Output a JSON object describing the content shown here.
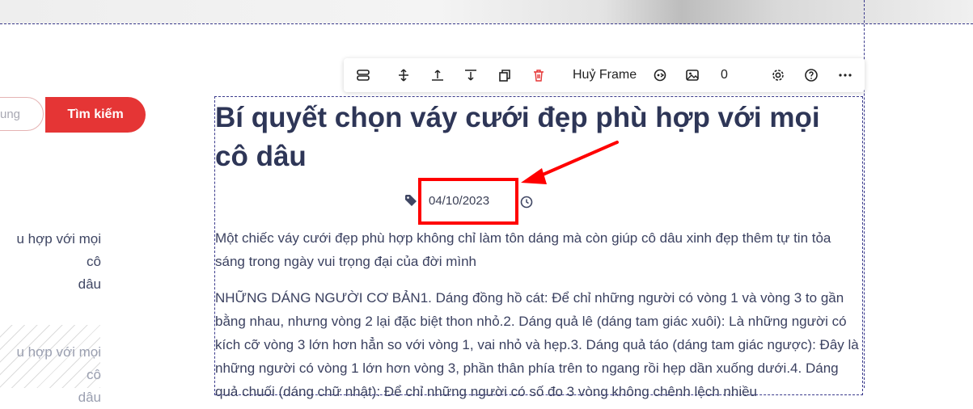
{
  "sidebar": {
    "search_placeholder": "ung",
    "search_button": "Tìm kiếm",
    "related": [
      {
        "line1": "u hợp với mọi cô",
        "line2": "dâu"
      },
      {
        "line1": "u hợp với mọi cô",
        "line2": "dâu"
      }
    ]
  },
  "toolbar": {
    "cancel_frame": "Huỷ Frame",
    "count": "0",
    "icons": [
      "layout-icon",
      "move-vertical-icon",
      "move-up-icon",
      "move-down-icon",
      "duplicate-icon",
      "trash-icon",
      "mask-icon",
      "image-icon",
      "gear-icon",
      "help-icon",
      "more-icon"
    ]
  },
  "article": {
    "title": "Bí quyết chọn váy cưới đẹp phù hợp với mọi cô dâu",
    "date": "04/10/2023",
    "intro": "Một chiếc váy cưới đẹp phù hợp không chỉ làm tôn dáng mà còn giúp cô dâu xinh đẹp thêm tự tin tỏa sáng trong ngày vui trọng đại của đời mình",
    "body": "NHỮNG DÁNG NGƯỜI CƠ BẢN1. Dáng đồng hồ cát: Để chỉ những người có vòng 1 và vòng 3 to gần bằng nhau, nhưng vòng 2 lại đặc biệt thon nhỏ.2. Dáng quả lê (dáng tam giác xuôi): Là những người có kích cỡ vòng 3 lớn hơn hẳn so với vòng 1, vai nhỏ và hẹp.3. Dáng quả táo (dáng tam giác ngược): Đây là những người có vòng 1 lớn hơn vòng 3, phần thân phía trên to ngang rồi hẹp dần xuống dưới.4. Dáng quả chuối (dáng chữ nhật): Để chỉ những người có số đo 3 vòng không chênh lệch nhiều"
  },
  "colors": {
    "accent": "#e53535",
    "annotation": "#ff0000",
    "title": "#2e3657"
  }
}
